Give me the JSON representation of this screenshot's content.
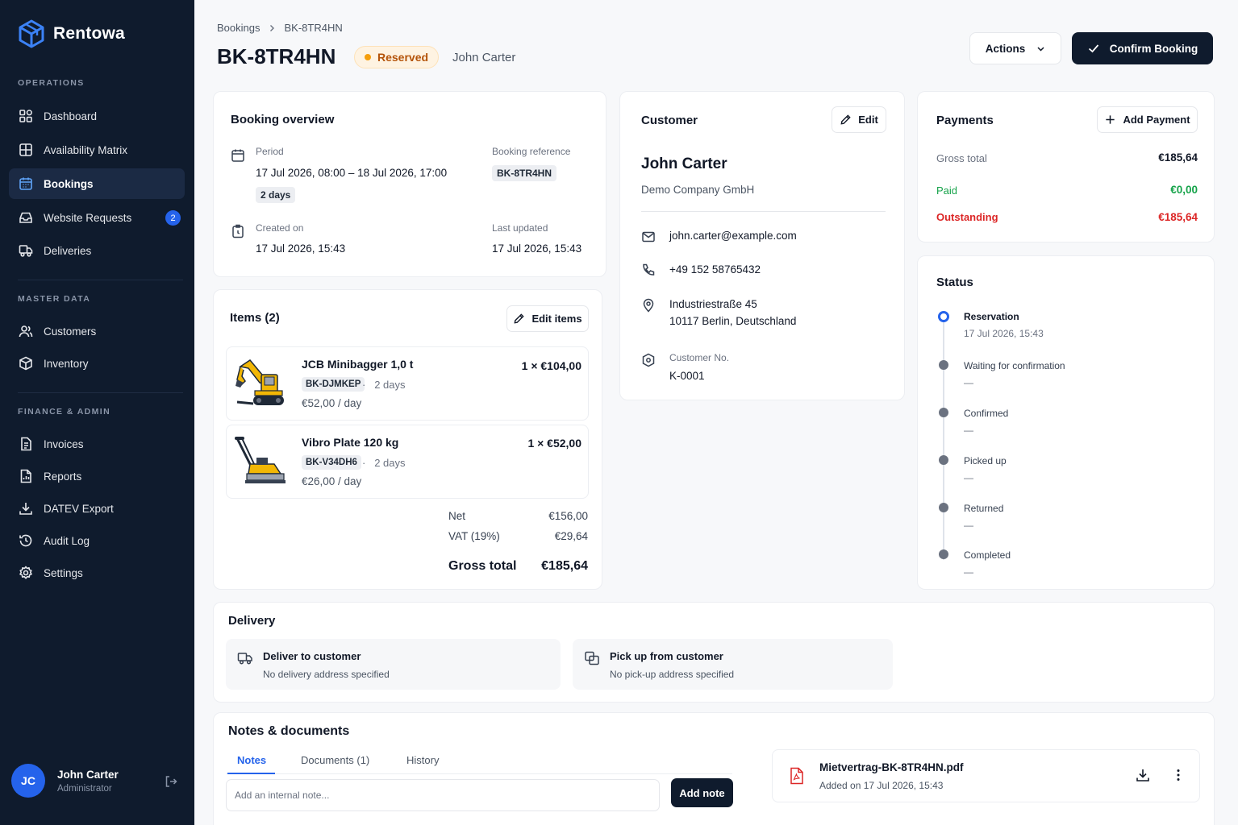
{
  "sidebar": {
    "brand": "Rentowa",
    "sections": [
      {
        "label": "OPERATIONS"
      },
      {
        "label": "MASTER DATA"
      },
      {
        "label": "FINANCE & ADMIN"
      }
    ],
    "items": [
      {
        "label": "Dashboard",
        "icon": "dashboard-icon"
      },
      {
        "label": "Availability Matrix",
        "icon": "grid-icon"
      },
      {
        "label": "Bookings",
        "icon": "calendar-icon",
        "active": true
      },
      {
        "label": "Website Requests",
        "icon": "inbox-icon",
        "badge": "2"
      },
      {
        "label": "Deliveries",
        "icon": "truck-icon"
      },
      {
        "label": "Customers",
        "icon": "users-icon"
      },
      {
        "label": "Inventory",
        "icon": "box-icon"
      },
      {
        "label": "Invoices",
        "icon": "invoice-icon"
      },
      {
        "label": "Reports",
        "icon": "report-icon"
      },
      {
        "label": "DATEV Export",
        "icon": "download-icon"
      },
      {
        "label": "Audit Log",
        "icon": "history-icon"
      },
      {
        "label": "Settings",
        "icon": "gear-icon"
      }
    ],
    "user": {
      "initials": "JC",
      "name": "John Carter",
      "role": "Administrator"
    }
  },
  "header": {
    "breadcrumb": [
      "Bookings",
      "BK-8TR4HN"
    ],
    "title": "BK-8TR4HN",
    "status": "Reserved",
    "customer": "John Carter",
    "actions_label": "Actions",
    "confirm_label": "Confirm Booking"
  },
  "overview": {
    "title": "Booking overview",
    "period_label": "Period",
    "period_value": "17 Jul 2026, 08:00 – 18 Jul 2026, 17:00",
    "duration": "2 days",
    "reference_label": "Booking reference",
    "reference_value": "BK-8TR4HN",
    "created_label": "Created on",
    "created_value": "17 Jul 2026, 15:43",
    "updated_label": "Last updated",
    "updated_value": "17 Jul 2026, 15:43"
  },
  "items": {
    "title": "Items (2)",
    "edit_label": "Edit items",
    "list": [
      {
        "name": "JCB Minibagger 1,0 t",
        "code": "BK-DJMKEP",
        "duration": "2 days",
        "rate": "€52,00 / day",
        "total": "1 × €104,00"
      },
      {
        "name": "Vibro Plate 120 kg",
        "code": "BK-V34DH6",
        "duration": "2 days",
        "rate": "€26,00 / day",
        "total": "1 × €52,00"
      }
    ],
    "net_label": "Net",
    "net_value": "€156,00",
    "vat_label": "VAT (19%)",
    "vat_value": "€29,64",
    "gross_label": "Gross total",
    "gross_value": "€185,64",
    "separator": "·"
  },
  "customer": {
    "title": "Customer",
    "edit_label": "Edit",
    "name": "John Carter",
    "company": "Demo Company GmbH",
    "email": "john.carter@example.com",
    "phone": "+49 152 58765432",
    "address_line1": "Industriestraße 45",
    "address_line2": "10117 Berlin, Deutschland",
    "number_label": "Customer No.",
    "number_value": "K-0001"
  },
  "payments": {
    "title": "Payments",
    "add_label": "Add Payment",
    "gross_label": "Gross total",
    "gross_value": "€185,64",
    "paid_label": "Paid",
    "paid_value": "€0,00",
    "outstanding_label": "Outstanding",
    "outstanding_value": "€185,64",
    "colors": {
      "paid": "#16a34a",
      "outstanding": "#dc2626"
    }
  },
  "status": {
    "title": "Status",
    "steps": [
      {
        "label": "Reservation",
        "sub": "17 Jul 2026, 15:43",
        "current": true
      },
      {
        "label": "Waiting for confirmation",
        "sub": "—"
      },
      {
        "label": "Confirmed",
        "sub": "—"
      },
      {
        "label": "Picked up",
        "sub": "—"
      },
      {
        "label": "Returned",
        "sub": "—"
      },
      {
        "label": "Completed",
        "sub": "—"
      }
    ]
  },
  "delivery": {
    "title": "Delivery",
    "deliver_title": "Deliver to customer",
    "deliver_sub": "No delivery address specified",
    "pickup_title": "Pick up from customer",
    "pickup_sub": "No pick-up address specified"
  },
  "notes": {
    "title": "Notes & documents",
    "tabs": [
      "Notes",
      "Documents (1)",
      "History"
    ],
    "placeholder": "Add an internal note...",
    "add_label": "Add note",
    "file_name": "Mietvertrag-BK-8TR4HN.pdf",
    "file_added": "Added on 17 Jul 2026, 15:43"
  }
}
